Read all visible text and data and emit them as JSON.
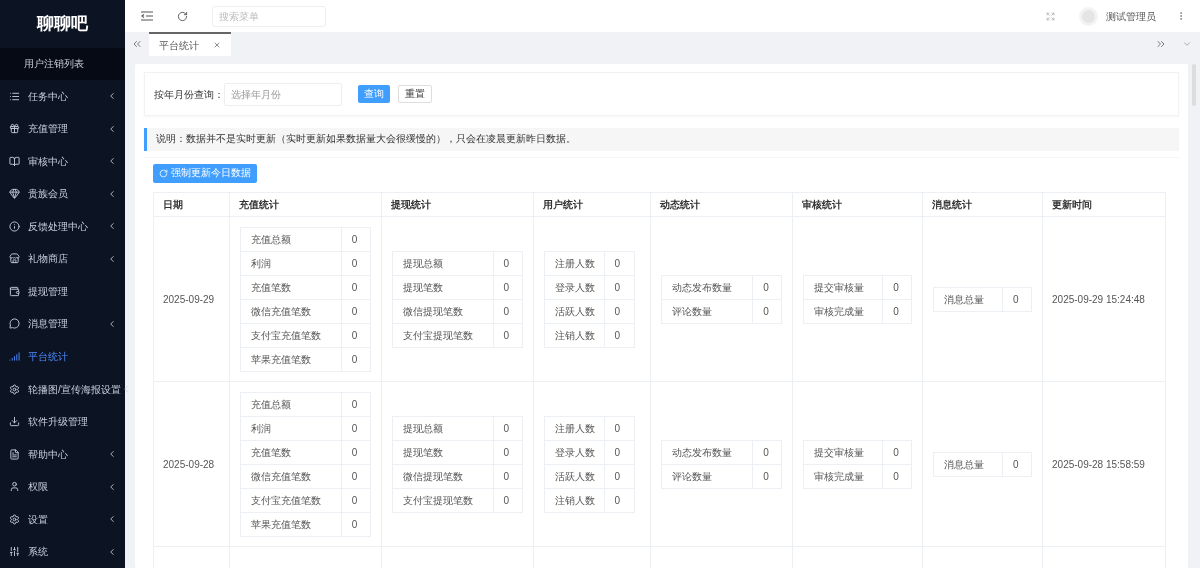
{
  "sidebar": {
    "logo": "聊聊吧",
    "items": [
      {
        "label": "用户注销列表",
        "kind": "sub",
        "selected": false
      },
      {
        "label": "任务中心",
        "kind": "menu",
        "has_children": true,
        "selected": false
      },
      {
        "label": "充值管理",
        "kind": "menu",
        "has_children": true,
        "selected": false
      },
      {
        "label": "审核中心",
        "kind": "menu",
        "has_children": true,
        "selected": false
      },
      {
        "label": "贵族会员",
        "kind": "menu",
        "has_children": true,
        "selected": false
      },
      {
        "label": "反馈处理中心",
        "kind": "menu",
        "has_children": true,
        "selected": false
      },
      {
        "label": "礼物商店",
        "kind": "menu",
        "has_children": true,
        "selected": false
      },
      {
        "label": "提现管理",
        "kind": "menu",
        "has_children": false,
        "selected": false
      },
      {
        "label": "消息管理",
        "kind": "menu",
        "has_children": true,
        "selected": false
      },
      {
        "label": "平台统计",
        "kind": "menu",
        "has_children": false,
        "selected": true
      },
      {
        "label": "轮播图/宣传海报设置",
        "kind": "menu",
        "has_children": true,
        "selected": false
      },
      {
        "label": "软件升级管理",
        "kind": "menu",
        "has_children": false,
        "selected": false
      },
      {
        "label": "帮助中心",
        "kind": "menu",
        "has_children": true,
        "selected": false
      },
      {
        "label": "权限",
        "kind": "menu",
        "has_children": true,
        "selected": false
      },
      {
        "label": "设置",
        "kind": "menu",
        "has_children": true,
        "selected": false
      },
      {
        "label": "系统",
        "kind": "menu",
        "has_children": true,
        "selected": false
      }
    ]
  },
  "topbar": {
    "search": {
      "placeholder": "搜索菜单"
    },
    "user": "测试管理员"
  },
  "tabs": [
    {
      "label": "平台统计",
      "selected": true
    }
  ],
  "query": {
    "label": "按年月份查询：",
    "field": {
      "placeholder": "选择年月份"
    },
    "buttons": [
      "查询",
      "重置"
    ]
  },
  "notice": "说明：数据并不是实时更新（实时更新如果数据量大会很缓慢的），只会在凌晨更新昨日数据。",
  "refresh_button": "强制更新今日数据",
  "table": {
    "columns": [
      "日期",
      "充值统计",
      "提现统计",
      "用户统计",
      "动态统计",
      "审核统计",
      "消息统计",
      "更新时间"
    ],
    "rows": [
      {
        "date": "2025-09-29",
        "updated": "2025-09-29 15:24:48",
        "recharge": [
          [
            "充值总额",
            "0"
          ],
          [
            "利润",
            "0"
          ],
          [
            "充值笔数",
            "0"
          ],
          [
            "微信充值笔数",
            "0"
          ],
          [
            "支付宝充值笔数",
            "0"
          ],
          [
            "苹果充值笔数",
            "0"
          ]
        ],
        "withdraw": [
          [
            "提现总额",
            "0"
          ],
          [
            "提现笔数",
            "0"
          ],
          [
            "微信提现笔数",
            "0"
          ],
          [
            "支付宝提现笔数",
            "0"
          ]
        ],
        "users": [
          [
            "注册人数",
            "0"
          ],
          [
            "登录人数",
            "0"
          ],
          [
            "活跃人数",
            "0"
          ],
          [
            "注销人数",
            "0"
          ]
        ],
        "dynamics": [
          [
            "动态发布数量",
            "0"
          ],
          [
            "评论数量",
            "0"
          ]
        ],
        "audit": [
          [
            "提交审核量",
            "0"
          ],
          [
            "审核完成量",
            "0"
          ]
        ],
        "messages": [
          [
            "消息总量",
            "0"
          ]
        ]
      },
      {
        "date": "2025-09-28",
        "updated": "2025-09-28 15:58:59",
        "recharge": [
          [
            "充值总额",
            "0"
          ],
          [
            "利润",
            "0"
          ],
          [
            "充值笔数",
            "0"
          ],
          [
            "微信充值笔数",
            "0"
          ],
          [
            "支付宝充值笔数",
            "0"
          ],
          [
            "苹果充值笔数",
            "0"
          ]
        ],
        "withdraw": [
          [
            "提现总额",
            "0"
          ],
          [
            "提现笔数",
            "0"
          ],
          [
            "微信提现笔数",
            "0"
          ],
          [
            "支付宝提现笔数",
            "0"
          ]
        ],
        "users": [
          [
            "注册人数",
            "0"
          ],
          [
            "登录人数",
            "0"
          ],
          [
            "活跃人数",
            "0"
          ],
          [
            "注销人数",
            "0"
          ]
        ],
        "dynamics": [
          [
            "动态发布数量",
            "0"
          ],
          [
            "评论数量",
            "0"
          ]
        ],
        "audit": [
          [
            "提交审核量",
            "0"
          ],
          [
            "审核完成量",
            "0"
          ]
        ],
        "messages": [
          [
            "消息总量",
            "0"
          ]
        ]
      }
    ]
  }
}
